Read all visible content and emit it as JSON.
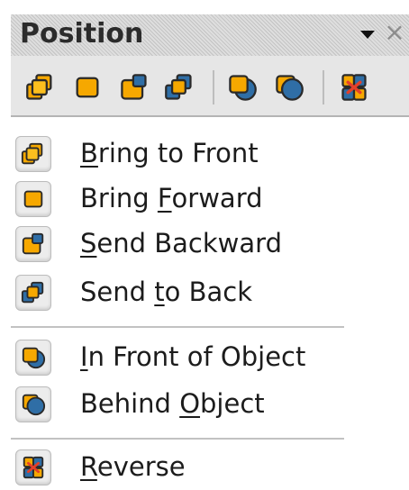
{
  "toolbar": {
    "title": "Position",
    "buttons": [
      {
        "icon": "bring-to-front-icon",
        "tooltip": "Bring to Front"
      },
      {
        "icon": "bring-forward-icon",
        "tooltip": "Bring Forward"
      },
      {
        "icon": "send-backward-icon",
        "tooltip": "Send Backward"
      },
      {
        "icon": "send-to-back-icon",
        "tooltip": "Send to Back"
      },
      {
        "icon": "in-front-of-object-icon",
        "tooltip": "In Front of Object"
      },
      {
        "icon": "behind-object-icon",
        "tooltip": "Behind Object"
      },
      {
        "icon": "reverse-icon",
        "tooltip": "Reverse"
      }
    ]
  },
  "menu": {
    "items": [
      {
        "icon": "bring-to-front-icon",
        "pre": "",
        "acc": "B",
        "post": "ring to Front"
      },
      {
        "icon": "bring-forward-icon",
        "pre": "Bring ",
        "acc": "F",
        "post": "orward"
      },
      {
        "icon": "send-backward-icon",
        "pre": "",
        "acc": "S",
        "post": "end Backward"
      },
      {
        "icon": "send-to-back-icon",
        "pre": "Send ",
        "acc": "t",
        "post": "o Back"
      },
      {
        "icon": "in-front-of-object-icon",
        "pre": "",
        "acc": "I",
        "post": "n Front of Object"
      },
      {
        "icon": "behind-object-icon",
        "pre": "Behind ",
        "acc": "O",
        "post": "bject"
      },
      {
        "icon": "reverse-icon",
        "pre": "",
        "acc": "R",
        "post": "everse"
      }
    ]
  },
  "colors": {
    "orange": "#f6a800",
    "blue": "#2f6ea6",
    "red": "#e4402a"
  }
}
